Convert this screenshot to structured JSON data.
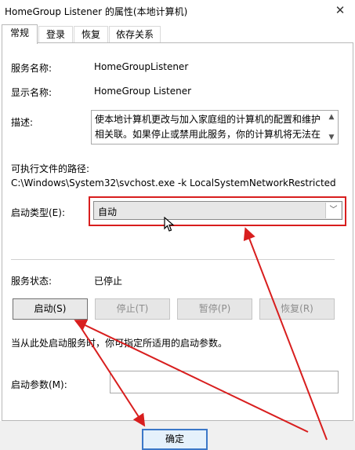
{
  "window": {
    "title": "HomeGroup Listener 的属性(本地计算机)",
    "close_glyph": "✕"
  },
  "tabs": [
    {
      "label": "常规",
      "active": true
    },
    {
      "label": "登录",
      "active": false
    },
    {
      "label": "恢复",
      "active": false
    },
    {
      "label": "依存关系",
      "active": false
    }
  ],
  "general": {
    "service_name_label": "服务名称:",
    "service_name_value": "HomeGroupListener",
    "display_name_label": "显示名称:",
    "display_name_value": "HomeGroup Listener",
    "description_label": "描述:",
    "description_lines": [
      "使本地计算机更改与加入家庭组的计算机的配置和维护",
      "相关联。如果停止或禁用此服务，你的计算机将无法在"
    ],
    "path_label": "可执行文件的路径:",
    "path_value": "C:\\Windows\\System32\\svchost.exe -k LocalSystemNetworkRestricted",
    "startup_type_label": "启动类型(E):",
    "startup_type_value": "自动",
    "service_status_label": "服务状态:",
    "service_status_value": "已停止",
    "buttons": {
      "start": "启动(S)",
      "stop": "停止(T)",
      "pause": "暂停(P)",
      "resume": "恢复(R)"
    },
    "hint": "当从此处启动服务时，你可指定所适用的启动参数。",
    "start_params_label": "启动参数(M):",
    "start_params_value": ""
  },
  "footer": {
    "ok_label": "确定"
  },
  "icons": {
    "scroll_up": "▲",
    "scroll_down": "▼",
    "dropdown_arrow": "﹀"
  },
  "annotation_color": "#d81e1e"
}
